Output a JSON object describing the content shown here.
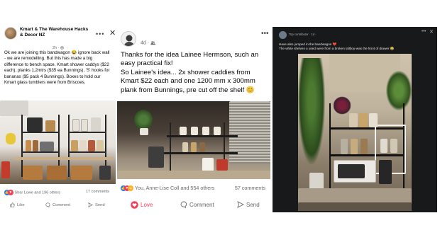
{
  "post1": {
    "group_name": "Kmart & The Warehouse Hacks & Decor NZ",
    "time": "2h",
    "more_icon": "ellipsis-icon",
    "close_icon": "close-icon",
    "body": "Ok we are joining this bandwagon 😂 ignore back wall - we are remodelling. But this has made a big difference to bench space. Kmart shower caddys ($22 each), planks 1,2mtrs ($35 ea Bunnings), 'S' hooks for bananas ($5 pack 4 Bunnings). Boxes to hold our Kmart glass tumblers were from Briscoes.",
    "reactions": "Shar Lowe and 196 others",
    "comments": "17 comments",
    "actions": {
      "like": "Like",
      "comment": "Comment",
      "send": "Send"
    }
  },
  "post2": {
    "time": "4d",
    "body_line1": "Thanks for the idea Lainee Hermson, such an easy practical fix!",
    "body_line2": "So Lainee's idea... 2x shower caddies from Kmart $22 each and one 1200 mm x 300mm plank from Bunnings, pre cut off the shelf 😊",
    "reactions": "You, Anne-Lise Coll and 554 others",
    "comments": "57 comments",
    "actions": {
      "love": "Love",
      "comment": "Comment",
      "send": "Send"
    }
  },
  "post3": {
    "contributor": "Top contributor · 1d ·",
    "text_line1": "Have also jumped in the bandwagon ❤️",
    "text_line2": "The white shelves u used were from a broken tallboy-was the front of drawer 😂"
  }
}
